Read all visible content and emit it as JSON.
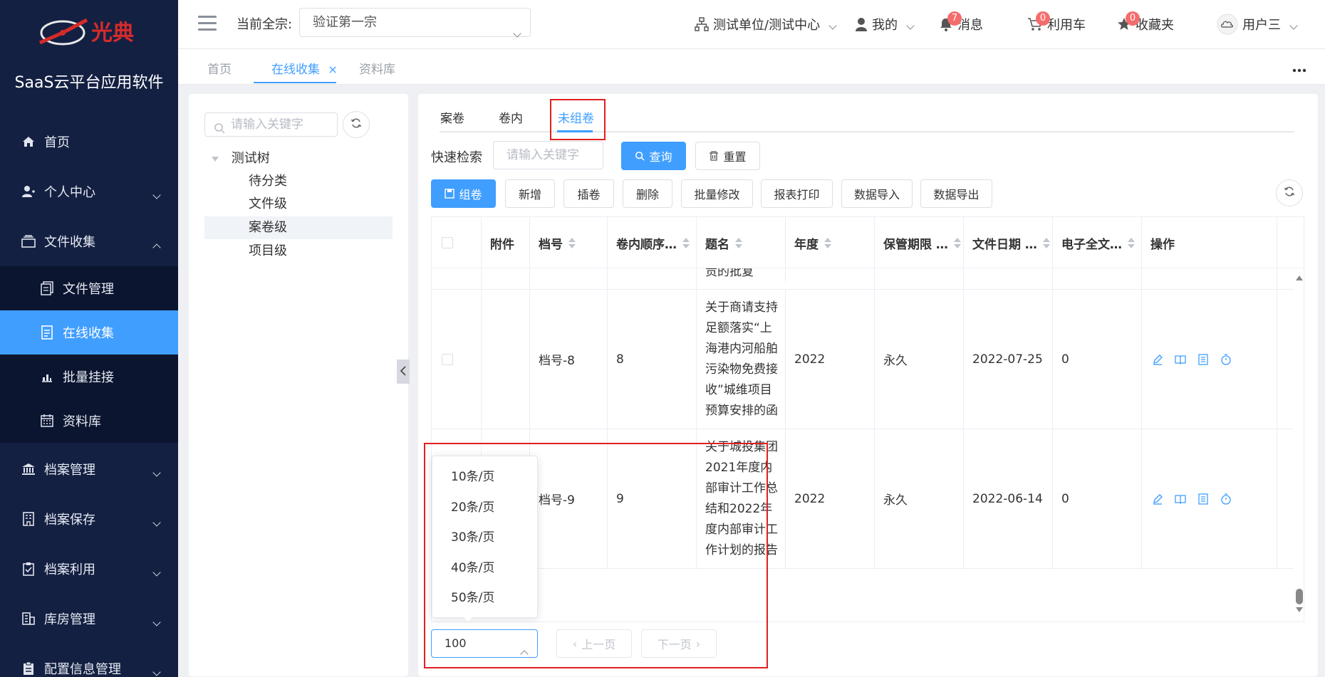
{
  "brand": {
    "logo_text": "光典",
    "app_name": "SaaS云平台应用软件"
  },
  "sidebar": {
    "items": [
      {
        "label": "首页",
        "icon": "home-icon"
      },
      {
        "label": "个人中心",
        "icon": "user-icon"
      },
      {
        "label": "文件收集",
        "icon": "inbox-icon"
      },
      {
        "label": "文件管理",
        "icon": "file-manage-icon"
      },
      {
        "label": "在线收集",
        "icon": "document-icon"
      },
      {
        "label": "批量挂接",
        "icon": "bar-chart-icon"
      },
      {
        "label": "资料库",
        "icon": "calendar-icon"
      },
      {
        "label": "档案管理",
        "icon": "bank-icon"
      },
      {
        "label": "档案保存",
        "icon": "building-icon"
      },
      {
        "label": "档案利用",
        "icon": "clipboard-check-icon"
      },
      {
        "label": "库房管理",
        "icon": "warehouse-icon"
      },
      {
        "label": "配置信息管理",
        "icon": "config-icon"
      }
    ]
  },
  "header": {
    "current_label": "当前全宗:",
    "current_value": "验证第一宗",
    "org": "测试单位/测试中心",
    "mine": "我的",
    "messages": "消息",
    "messages_badge": "7",
    "cart": "利用车",
    "cart_badge": "0",
    "favorites": "收藏夹",
    "favorites_badge": "0",
    "user": "用户三"
  },
  "page_tabs": [
    {
      "label": "首页"
    },
    {
      "label": "在线收集"
    },
    {
      "label": "资料库"
    }
  ],
  "tree": {
    "search_placeholder": "请输入关键字",
    "root": "测试树",
    "children": [
      "待分类",
      "文件级",
      "案卷级",
      "项目级"
    ]
  },
  "sub_tabs": [
    "案卷",
    "卷内",
    "未组卷"
  ],
  "search": {
    "label": "快速检索",
    "placeholder": "请输入关键字",
    "query": "查询",
    "reset": "重置"
  },
  "toolbar": {
    "group": "组卷",
    "add": "新增",
    "insert": "插卷",
    "delete": "删除",
    "batch_edit": "批量修改",
    "print": "报表打印",
    "import": "数据导入",
    "export": "数据导出"
  },
  "table": {
    "columns": [
      "附件",
      "档号",
      "卷内顺序…",
      "题名",
      "年度",
      "保管期限 …",
      "文件日期 …",
      "电子全文…",
      "操作"
    ],
    "partial_row_text": "贡的批复",
    "rows": [
      {
        "attachment": "",
        "archive_no": "档号-8",
        "order": "8",
        "title": "关于商请支持足额落实“上海港内河船舶污染物免费接收”城维项目预算安排的函",
        "year": "2022",
        "retention": "永久",
        "date": "2022-07-25",
        "efulltext": "0"
      },
      {
        "attachment": "",
        "archive_no": "档号-9",
        "order": "9",
        "title": "关于城投集团2021年度内部审计工作总结和2022年度内部审计工作计划的报告",
        "year": "2022",
        "retention": "永久",
        "date": "2022-06-14",
        "efulltext": "0"
      }
    ]
  },
  "pagination": {
    "page_size": "100",
    "prev": "上一页",
    "next": "下一页",
    "options": [
      "10条/页",
      "20条/页",
      "30条/页",
      "40条/页",
      "50条/页"
    ]
  }
}
